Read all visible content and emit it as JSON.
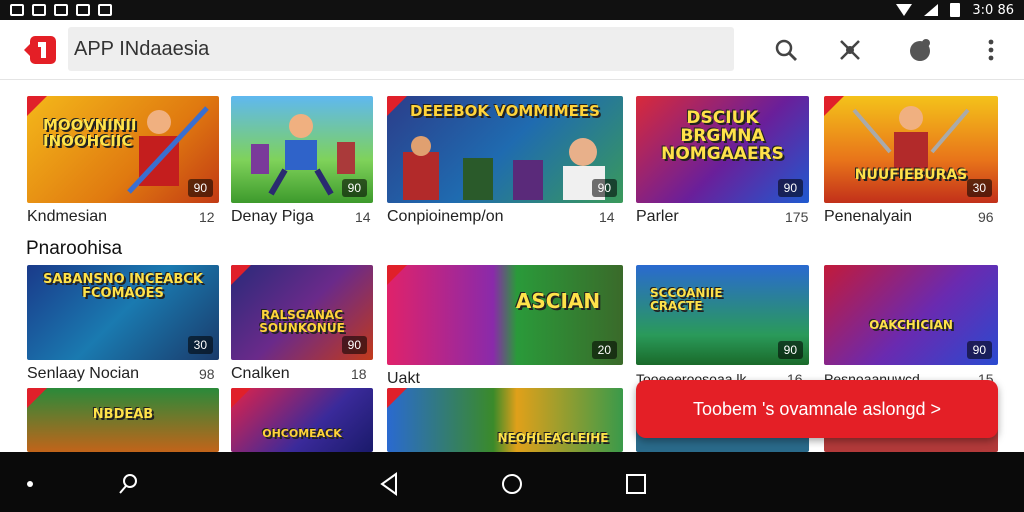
{
  "status": {
    "time": "3:0 86"
  },
  "search": {
    "text": "APP INdaaesia"
  },
  "colors": {
    "accent": "#e41f26",
    "navbar": "#0a0a0a"
  },
  "icons": {
    "back": "back-arrow-icon",
    "search": "search-icon",
    "mic": "mic-icon",
    "account": "account-icon",
    "more": "more-vert-icon"
  },
  "row1": [
    {
      "title": "MOOVNINII INOOHCIIC",
      "caption": "Kndmesian",
      "count": "12",
      "badge": "90"
    },
    {
      "title": "",
      "caption": "Denay Piga",
      "count": "14",
      "badge": "90"
    },
    {
      "title": "DEEEBOK VOMMIMEES",
      "caption": "Conpioinemp/on",
      "count": "14",
      "badge": "90"
    },
    {
      "title": "DSCIUK BRGMNA NOMGAAERS",
      "caption": "Parler",
      "count": "175",
      "badge": "90"
    },
    {
      "title": "NUUFIEBURAS",
      "caption": "Penenalyain",
      "count": "96",
      "badge": "30"
    }
  ],
  "section_title": "Pnaroohisa",
  "row2": [
    {
      "title": "SABANSNO INCEABCK FCOMAOES",
      "caption": "Senlaay Nocian",
      "count": "98",
      "badge": "30"
    },
    {
      "title": "RALSGANAC SOUNKONUE",
      "caption": "Cnalken",
      "count": "18",
      "badge": "90"
    },
    {
      "title": "ASCIAN",
      "caption": "Uakt",
      "count": "",
      "badge": "20"
    },
    {
      "title": "SCCOANIIE CRACTE",
      "caption": "Tooeeeroosoaa lk...",
      "count": "16",
      "badge": "90"
    },
    {
      "title": "OAKCHICIAN",
      "caption": "Pesnoaanuwcd",
      "count": "15",
      "badge": "90"
    }
  ],
  "row3": [
    {
      "title": "NBDEAB"
    },
    {
      "title": "OHCOMEACK"
    },
    {
      "title": "NEOHLEACLEIHE"
    },
    {
      "title": ""
    },
    {
      "title": ""
    }
  ],
  "toast": {
    "text": "Toobem 's ovamnale aslongd >"
  }
}
